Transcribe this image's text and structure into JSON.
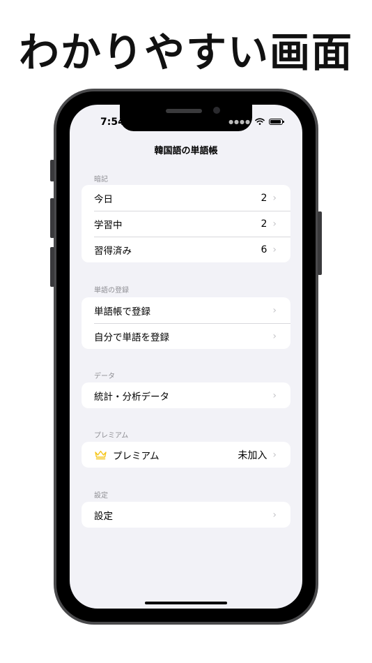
{
  "headline": "わかりやすい画面",
  "status": {
    "time": "7:54"
  },
  "nav": {
    "title": "韓国語の単語帳"
  },
  "sections": {
    "memorize": {
      "header": "暗記",
      "rows": [
        {
          "label": "今日",
          "value": "2"
        },
        {
          "label": "学習中",
          "value": "2"
        },
        {
          "label": "習得済み",
          "value": "6"
        }
      ]
    },
    "register": {
      "header": "単語の登録",
      "rows": [
        {
          "label": "単語帳で登録"
        },
        {
          "label": "自分で単語を登録"
        }
      ]
    },
    "data": {
      "header": "データ",
      "rows": [
        {
          "label": "統計・分析データ"
        }
      ]
    },
    "premium": {
      "header": "プレミアム",
      "rows": [
        {
          "label": "プレミアム",
          "value": "未加入",
          "icon": "crown-icon"
        }
      ]
    },
    "settings": {
      "header": "設定",
      "rows": [
        {
          "label": "設定"
        }
      ]
    }
  },
  "colors": {
    "background": "#f2f2f7",
    "crown": "#f5c518",
    "chevron": "#c4c4c8"
  }
}
